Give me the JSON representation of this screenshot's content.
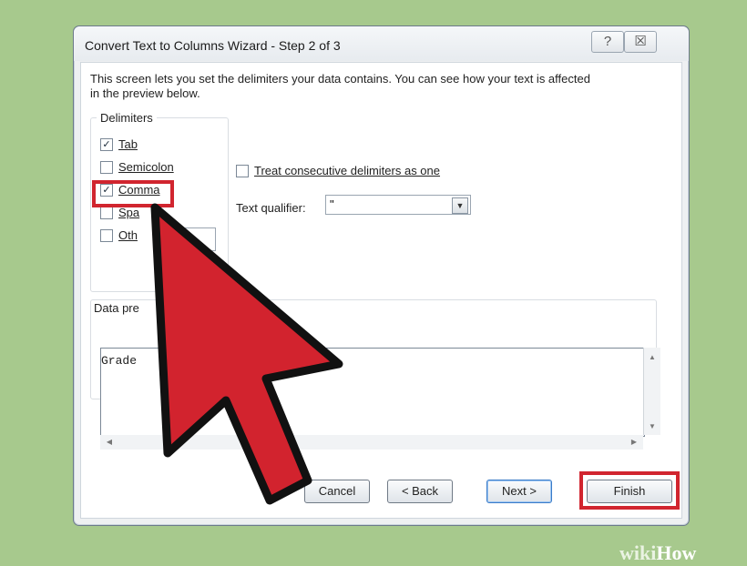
{
  "dialog": {
    "title": "Convert Text to Columns Wizard - Step 2 of 3",
    "help_glyph": "?",
    "close_glyph": "☒",
    "intro_line1": "This screen lets you set the delimiters your data contains.  You can see how your text is affected",
    "intro_line2": "in the preview below."
  },
  "delimiters": {
    "label": "Delimiters",
    "items": [
      {
        "label": "Tab",
        "checked": true
      },
      {
        "label": "Semicolon",
        "checked": false
      },
      {
        "label": "Comma",
        "checked": true
      },
      {
        "label": "Spa",
        "checked": false
      },
      {
        "label": "Oth",
        "checked": false
      }
    ]
  },
  "options": {
    "consecutive_label": "Treat consecutive delimiters as one",
    "qualifier_label": "Text qualifier:",
    "qualifier_value": "\""
  },
  "preview": {
    "label": "Data pre",
    "text": "Grade"
  },
  "buttons": {
    "cancel": "Cancel",
    "back": "< Back",
    "next": "Next >",
    "finish": "Finish"
  },
  "watermark": {
    "wiki": "wiki",
    "how": "How"
  },
  "colors": {
    "highlight": "#d1252f",
    "background": "#a7c98d"
  }
}
